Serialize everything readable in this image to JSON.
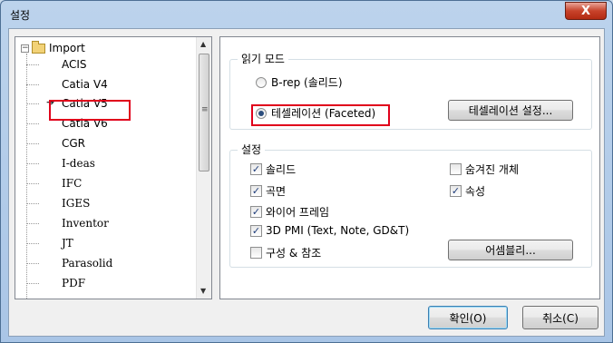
{
  "window": {
    "title": "설정",
    "close_label": "X"
  },
  "tree": {
    "root_label": "Import",
    "expander": "−",
    "items": [
      {
        "label": "ACIS"
      },
      {
        "label": "Catia V4"
      },
      {
        "label": "Catia V5",
        "selected": true
      },
      {
        "label": "Catia V6"
      },
      {
        "label": "CGR"
      },
      {
        "label": "I-deas"
      },
      {
        "label": "IFC"
      },
      {
        "label": "IGES"
      },
      {
        "label": "Inventor"
      },
      {
        "label": "JT"
      },
      {
        "label": "Parasolid"
      },
      {
        "label": "PDF"
      }
    ],
    "scroll_up": "▲",
    "scroll_down": "▼",
    "thumb_grip": "≡",
    "selected_arrow": "➔"
  },
  "read_mode": {
    "title": "읽기 모드",
    "option_brep": "B-rep (솔리드)",
    "option_faceted": "테셀레이션 (Faceted)",
    "selected": "faceted",
    "tess_settings_button": "테셀레이션 설정..."
  },
  "settings": {
    "title": "설정",
    "solid": {
      "label": "솔리드",
      "checked": true
    },
    "surface": {
      "label": "곡면",
      "checked": true
    },
    "wireframe": {
      "label": "와이어 프레임",
      "checked": true
    },
    "pmi": {
      "label": "3D PMI (Text, Note, GD&T)",
      "checked": true
    },
    "construction": {
      "label": "구성 & 참조",
      "checked": false
    },
    "hidden": {
      "label": "숨겨진 개체",
      "checked": false
    },
    "attributes": {
      "label": "속성",
      "checked": true
    },
    "assembly_button": "어셈블리..."
  },
  "footer": {
    "ok": "확인(O)",
    "cancel": "취소(C)"
  },
  "colors": {
    "highlight": "#e0001b",
    "titlebar": "#bcd3ec",
    "close": "#c7432b"
  }
}
